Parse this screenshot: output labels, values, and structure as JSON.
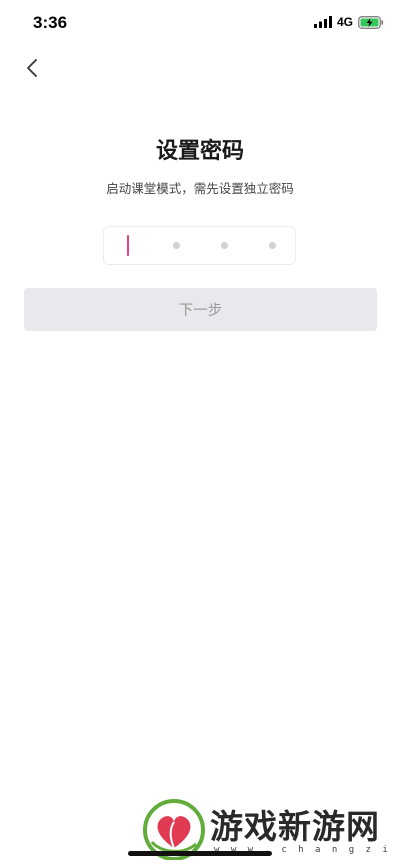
{
  "status_bar": {
    "time": "3:36",
    "network": "4G"
  },
  "header": {
    "back_icon": "chevron-left-icon"
  },
  "main": {
    "title": "设置密码",
    "subtitle": "启动课堂模式，需先设置独立密码",
    "pin": {
      "length": 4,
      "filled": 0
    },
    "next_button_label": "下一步"
  },
  "colors": {
    "caret": "#e8407a",
    "button_bg_disabled": "#e8e9ec",
    "button_text_disabled": "#9a9a9a",
    "battery_charging": "#34c759"
  },
  "watermark": {
    "text": "游戏新游网",
    "url": "w w w . c h a n g z i z h u . c o m"
  }
}
